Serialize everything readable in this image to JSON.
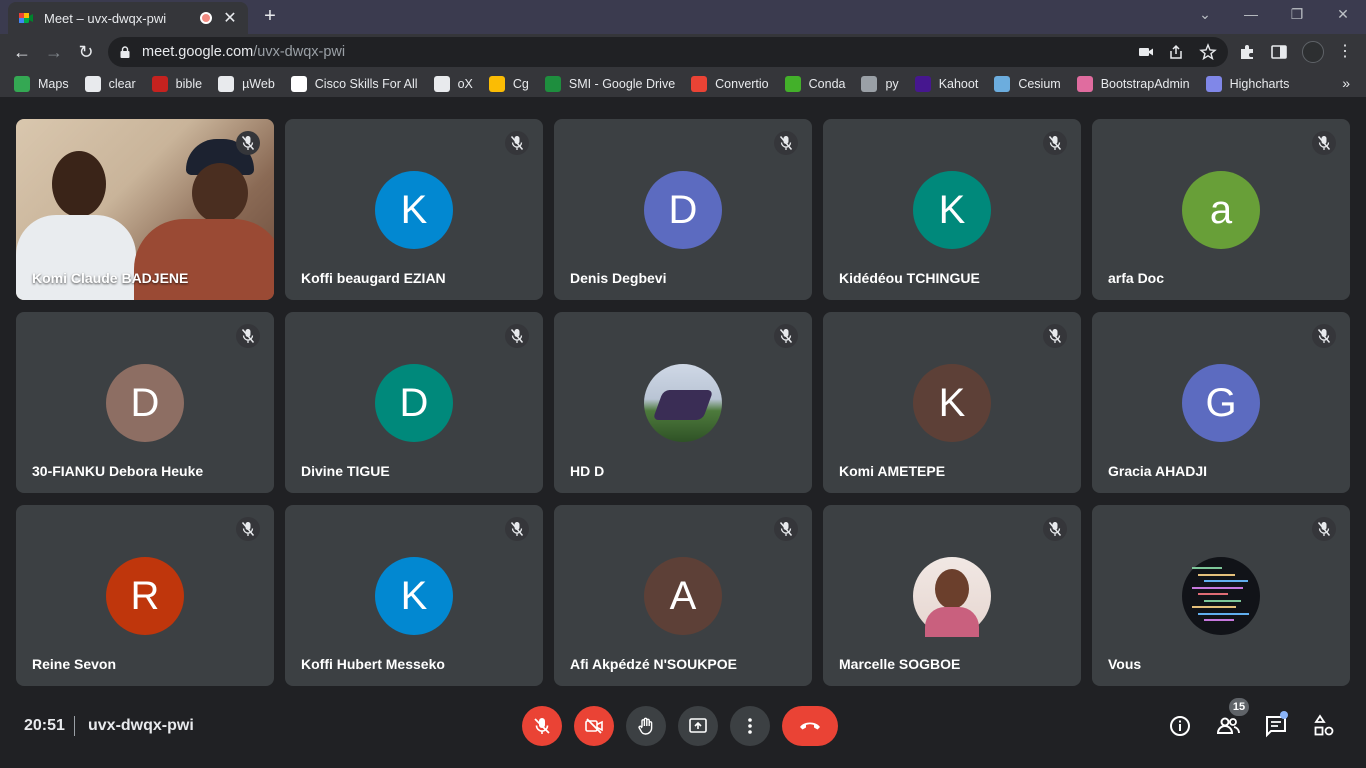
{
  "browser": {
    "tab_title": "Meet – uvx-dwqx-pwi",
    "tab_close": "✕",
    "new_tab": "+",
    "url_host": "meet.google.com",
    "url_path": "/uvx-dwqx-pwi"
  },
  "bookmarks": [
    {
      "label": "Maps",
      "icon_color": "#34a853"
    },
    {
      "label": "clear",
      "icon_color": "#e8eaed"
    },
    {
      "label": "bible",
      "icon_color": "#c5221f"
    },
    {
      "label": "µWeb",
      "icon_color": "#e8eaed"
    },
    {
      "label": "Cisco Skills For All",
      "icon_color": "#ffffff"
    },
    {
      "label": "oX",
      "icon_color": "#e8eaed"
    },
    {
      "label": "Cg",
      "icon_color": "#fbbc04"
    },
    {
      "label": "SMI - Google Drive",
      "icon_color": "#1e8e3e"
    },
    {
      "label": "Convertio",
      "icon_color": "#ea4335"
    },
    {
      "label": "Conda",
      "icon_color": "#43b02a"
    },
    {
      "label": "py",
      "icon_color": "#9aa0a6"
    },
    {
      "label": "Kahoot",
      "icon_color": "#46178f"
    },
    {
      "label": "Cesium",
      "icon_color": "#6cadde"
    },
    {
      "label": "BootstrapAdmin",
      "icon_color": "#e06c9f"
    },
    {
      "label": "Highcharts",
      "icon_color": "#8087e8"
    }
  ],
  "bookmarks_more": "»",
  "participants": [
    {
      "name": "Komi Claude BADJENE",
      "initial": "",
      "color": "",
      "kind": "video"
    },
    {
      "name": "Koffi beaugard EZIAN",
      "initial": "K",
      "color": "#0288d1",
      "kind": "letter"
    },
    {
      "name": "Denis Degbevi",
      "initial": "D",
      "color": "#5c6bc0",
      "kind": "letter"
    },
    {
      "name": "Kidédéou TCHINGUE",
      "initial": "K",
      "color": "#00897b",
      "kind": "letter"
    },
    {
      "name": "arfa Doc",
      "initial": "a",
      "color": "#689f38",
      "kind": "letter"
    },
    {
      "name": "30-FIANKU Debora Heuke",
      "initial": "D",
      "color": "#8d6e63",
      "kind": "letter"
    },
    {
      "name": "Divine TIGUE",
      "initial": "D",
      "color": "#00897b",
      "kind": "letter"
    },
    {
      "name": "HD D",
      "initial": "",
      "color": "",
      "kind": "photo-dance"
    },
    {
      "name": "Komi AMETEPE",
      "initial": "K",
      "color": "#5d4037",
      "kind": "letter"
    },
    {
      "name": "Gracia AHADJI",
      "initial": "G",
      "color": "#5c6bc0",
      "kind": "letter"
    },
    {
      "name": "Reine Sevon",
      "initial": "R",
      "color": "#bf360c",
      "kind": "letter"
    },
    {
      "name": "Koffi Hubert Messeko",
      "initial": "K",
      "color": "#0288d1",
      "kind": "letter"
    },
    {
      "name": "Afi Akpédzé N'SOUKPOE",
      "initial": "A",
      "color": "#5d4037",
      "kind": "letter"
    },
    {
      "name": "Marcelle SOGBOE",
      "initial": "",
      "color": "",
      "kind": "photo-portrait"
    },
    {
      "name": "Vous",
      "initial": "",
      "color": "",
      "kind": "photo-code"
    }
  ],
  "meeting": {
    "time": "20:51",
    "code": "uvx-dwqx-pwi",
    "participant_count": "15"
  }
}
